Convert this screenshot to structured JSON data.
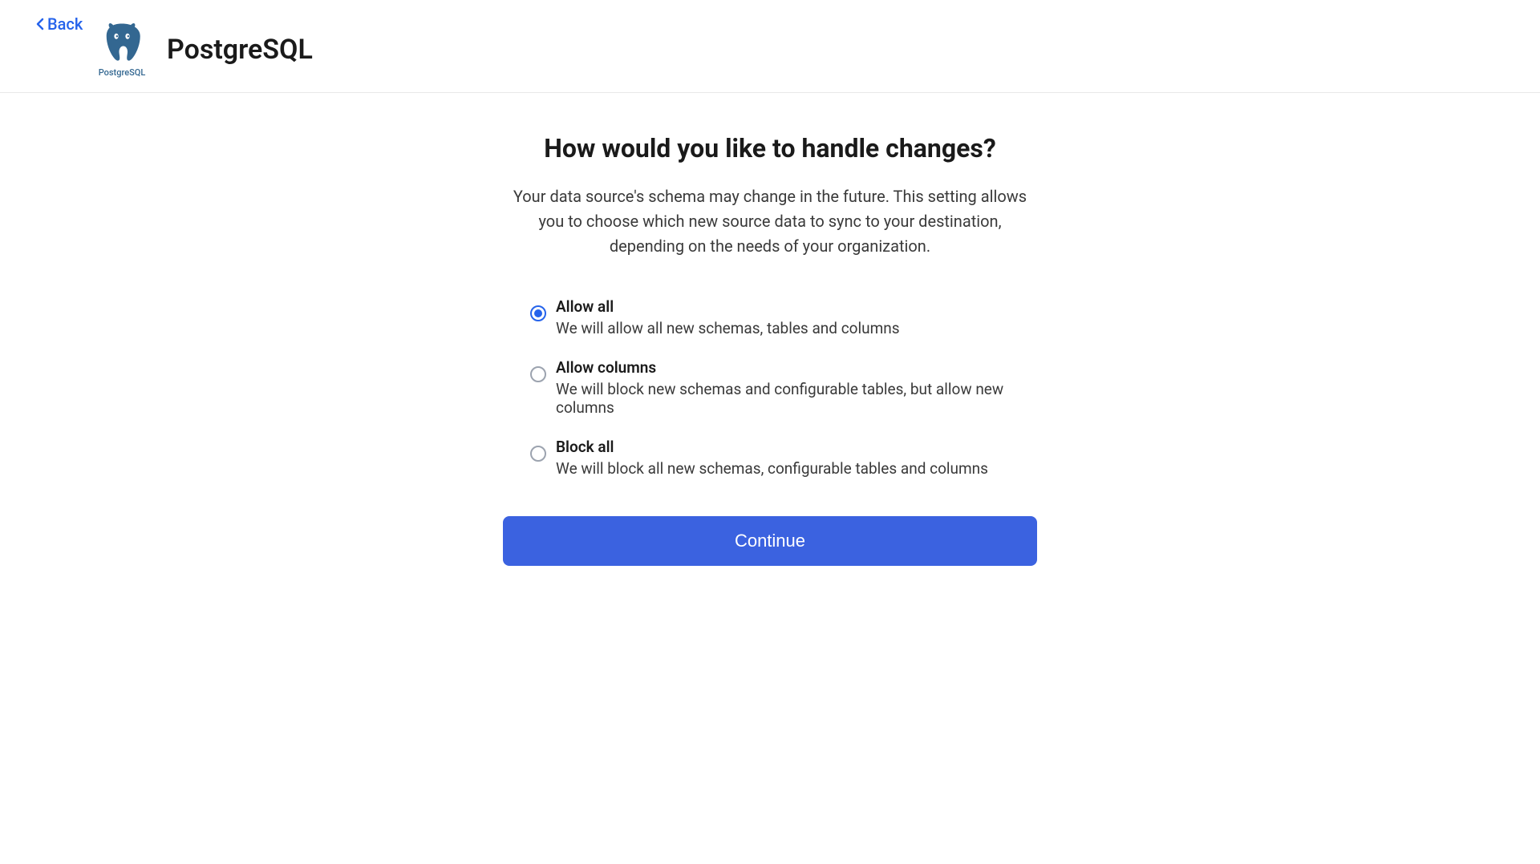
{
  "header": {
    "back_label": "Back",
    "connector_name": "PostgreSQL",
    "logo_caption": "PostgreSQL"
  },
  "main": {
    "question": "How would you like to handle changes?",
    "description": "Your data source's schema may change in the future. This setting allows you to choose which new source data to sync to your destination, depending on the needs of your organization.",
    "continue_label": "Continue"
  },
  "options": [
    {
      "title": "Allow all",
      "description": "We will allow all new schemas, tables and columns",
      "selected": true
    },
    {
      "title": "Allow columns",
      "description": "We will block new schemas and configurable tables, but allow new columns",
      "selected": false
    },
    {
      "title": "Block all",
      "description": "We will block all new schemas, configurable tables and columns",
      "selected": false
    }
  ]
}
